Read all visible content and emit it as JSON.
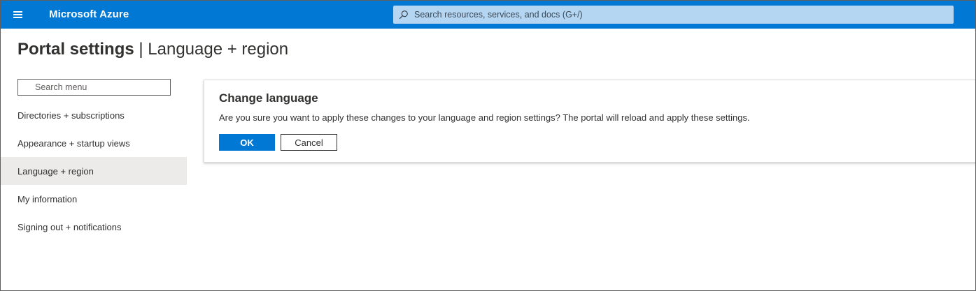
{
  "topbar": {
    "brand": "Microsoft Azure",
    "search_placeholder": "Search resources, services, and docs (G+/)",
    "background_color": "#0078d4"
  },
  "page": {
    "title_main": "Portal settings",
    "title_separator": "|",
    "title_sub": "Language + region"
  },
  "sidebar": {
    "search_placeholder": "Search menu",
    "items": [
      {
        "label": "Directories + subscriptions",
        "selected": false
      },
      {
        "label": "Appearance + startup views",
        "selected": false
      },
      {
        "label": "Language + region",
        "selected": true
      },
      {
        "label": "My information",
        "selected": false
      },
      {
        "label": "Signing out + notifications",
        "selected": false
      }
    ]
  },
  "dialog": {
    "title": "Change language",
    "message": "Are you sure you want to apply these changes to your language and region settings? The portal will reload and apply these settings.",
    "ok_label": "OK",
    "cancel_label": "Cancel"
  },
  "icons": {
    "menu": "hamburger-icon",
    "search": "search-icon"
  }
}
